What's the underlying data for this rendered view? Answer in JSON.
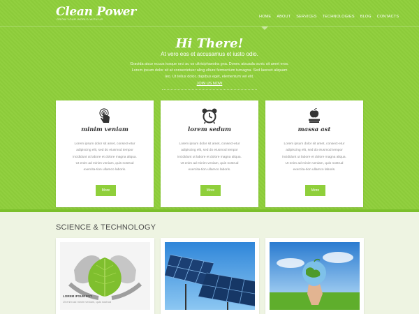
{
  "brand": {
    "logo": "Clean Power",
    "tagline": "GROW YOUR WORLD WITH US"
  },
  "nav": {
    "items": [
      "HOME",
      "ABOUT",
      "SERVICES",
      "TECHNOLOGIES",
      "BLOG",
      "CONTACTS"
    ]
  },
  "hero": {
    "heading": "Hi There!",
    "subheading": "At vero eos et accusamus et iusto odio.",
    "body": "Gravida atcur ecuus iosque orci ac os ultriciphaestra gna. Donec atsuada ocnic sit amet eros. Lorem ipsum dolor sit at consectetuer aling elture fermentum tumagna. Sed laoreet aliquam leo. Ut tellus dolor, dapibus eget, elementum vel elit.",
    "link": "JOIN US NOW"
  },
  "features": [
    {
      "icon": "touch-hand-icon",
      "title": "minim veniam",
      "text": "Lorem ipsum dolor sit amet, consect-etur adipiscing elit, sed do eiusmod tempor incididunt ut labore et dolore magna aliqua. Ut enim ad minim veniam, quis nostrud exercita-tion ullamco laboris.",
      "button": "More"
    },
    {
      "icon": "alarm-clock-icon",
      "title": "lorem sedum",
      "text": "Lorem ipsum dolor sit amet, consect-etur adipiscing elit, sed do eiusmod tempor incididunt ut labore et dolore magna aliqua. Ut enim ad minim veniam, quis nostrud exercita-tion ullamco laboris.",
      "button": "More"
    },
    {
      "icon": "apple-books-icon",
      "title": "massa ast",
      "text": "Lorem ipsum dolor sit amet, consect-etur adipiscing elit, sed do eiusmod tempor incididunt ut labore et dolore magna aliqua. Ut enim ad minim veniam, quis nostrud exercita-tion ullamco laboris.",
      "button": "More"
    }
  ],
  "science": {
    "title": "SCIENCE & TECHNOLOGY",
    "photos": [
      {
        "name": "hands-leaf-photo"
      },
      {
        "name": "solar-panels-photo"
      },
      {
        "name": "globe-in-hand-photo"
      }
    ],
    "caption_title": "LOREM IPSUM EST.",
    "caption_text": "Ut enim ad minim veniam, quis nostrud"
  },
  "colors": {
    "brand_green": "#8fcf3b",
    "background": "#eef4e2"
  }
}
